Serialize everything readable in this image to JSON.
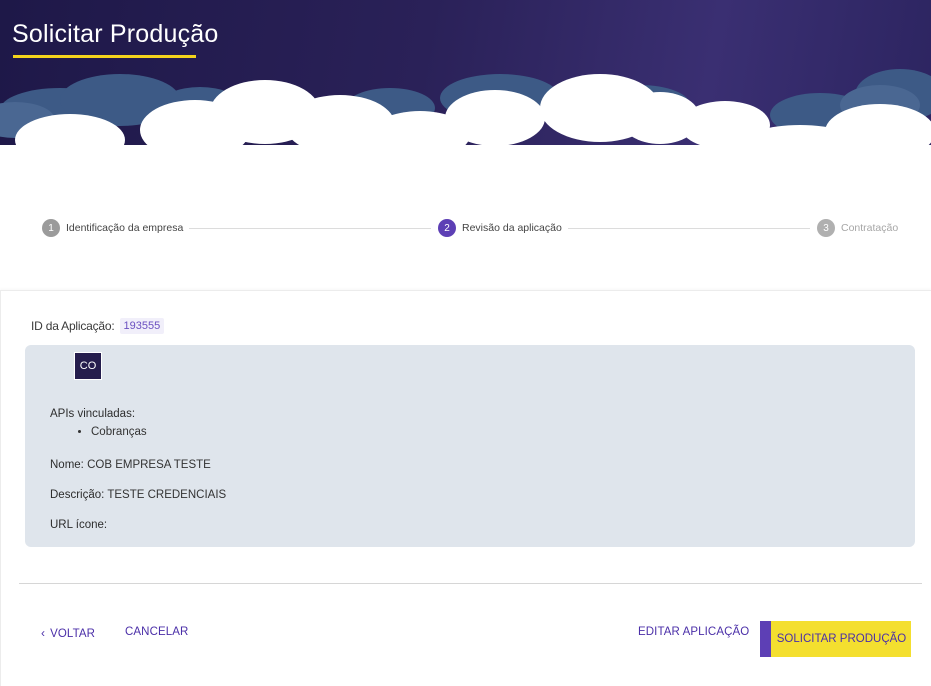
{
  "header": {
    "title": "Solicitar Produção"
  },
  "stepper": {
    "steps": [
      {
        "number": "1",
        "label": "Identificação da empresa",
        "state": "done"
      },
      {
        "number": "2",
        "label": "Revisão da aplicação",
        "state": "active"
      },
      {
        "number": "3",
        "label": "Contratação",
        "state": "todo"
      }
    ]
  },
  "application": {
    "id_label": "ID da Aplicação:",
    "id_value": "193555",
    "avatar_initials": "CO",
    "apis_label": "APIs vinculadas:",
    "apis": [
      "Cobranças"
    ],
    "name_label": "Nome:",
    "name_value": "COB EMPRESA TESTE",
    "description_label": "Descrição:",
    "description_value": "TESTE CREDENCIAIS",
    "icon_url_label": "URL ícone:",
    "icon_url_value": ""
  },
  "actions": {
    "back_label": "VOLTAR",
    "cancel_label": "CANCELAR",
    "edit_label": "EDITAR APLICAÇÃO",
    "submit_label": "SOLICITAR PRODUÇÃO",
    "back_icon": "chevron-left-icon"
  },
  "colors": {
    "accent_purple": "#5d3fb5",
    "accent_yellow": "#f4d31c",
    "header_dark": "#1e1848",
    "info_box_bg": "#dfe5ec"
  }
}
